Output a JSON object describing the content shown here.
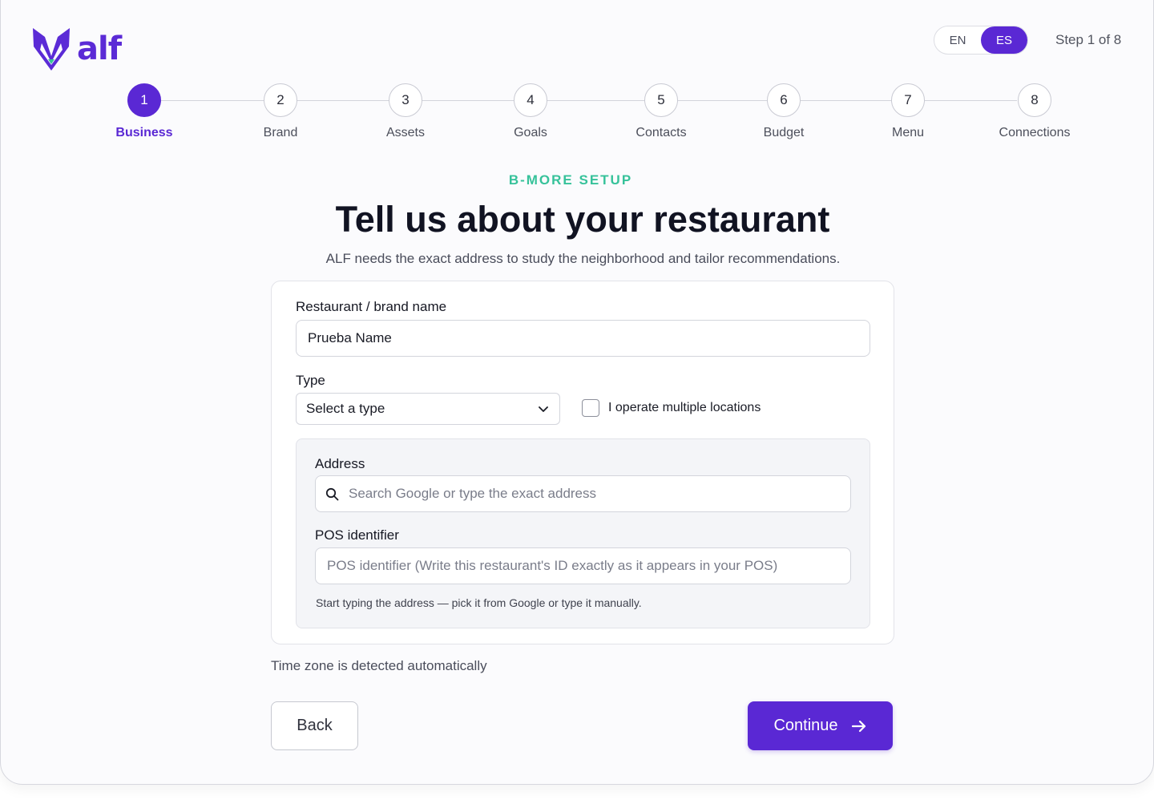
{
  "brand": {
    "logo_text": "alf",
    "accent": "#5a28d4",
    "eyebrow_color": "#36c29a"
  },
  "language": {
    "options": [
      "EN",
      "ES"
    ],
    "selected": "ES"
  },
  "step_counter": "Step 1 of 8",
  "stepper": {
    "active_index": 0,
    "steps": [
      {
        "number": "1",
        "label": "Business"
      },
      {
        "number": "2",
        "label": "Brand"
      },
      {
        "number": "3",
        "label": "Assets"
      },
      {
        "number": "4",
        "label": "Goals"
      },
      {
        "number": "5",
        "label": "Contacts"
      },
      {
        "number": "6",
        "label": "Budget"
      },
      {
        "number": "7",
        "label": "Menu"
      },
      {
        "number": "8",
        "label": "Connections"
      }
    ]
  },
  "header": {
    "eyebrow": "B-MORE SETUP",
    "title": "Tell us about your restaurant",
    "subtitle": "ALF needs the exact address to study the neighborhood and tailor recommendations."
  },
  "form": {
    "name_label": "Restaurant / brand name",
    "name_value": "Prueba Name",
    "type_label": "Type",
    "type_value": "Select a type",
    "multiple_locations_label": "I operate multiple locations",
    "multiple_locations_checked": false,
    "address_label": "Address",
    "address_placeholder": "Search Google or type the exact address",
    "pos_label": "POS identifier",
    "pos_placeholder": "POS identifier (Write this restaurant's ID exactly as it appears in your POS)",
    "address_hint": "Start typing the address — pick it from Google or type it manually."
  },
  "timezone_note": "Time zone is detected automatically",
  "actions": {
    "back_label": "Back",
    "continue_label": "Continue"
  },
  "icons": {
    "search": "search-icon",
    "chevron": "chevron-down-icon",
    "arrow": "arrow-right-icon",
    "logo": "fox-logo-icon"
  }
}
